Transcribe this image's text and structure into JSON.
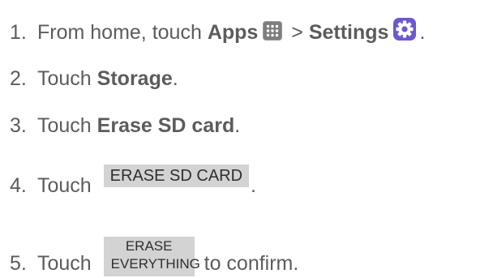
{
  "steps": [
    {
      "number": "1.",
      "text_before": "From home, touch ",
      "bold1": "Apps",
      "icon1": "apps-grid-icon",
      "sep": " > ",
      "bold2": "Settings",
      "icon2": "settings-gear-icon",
      "text_after": "."
    },
    {
      "number": "2.",
      "text_before": "Touch ",
      "bold": "Storage",
      "text_after": "."
    },
    {
      "number": "3.",
      "text_before": "Touch ",
      "bold": "Erase SD card",
      "text_after": "."
    },
    {
      "number": "4.",
      "text_before": "Touch ",
      "button_label": "ERASE SD CARD",
      "text_after": "."
    },
    {
      "number": "5.",
      "text_before": "Touch ",
      "button_line1": "ERASE",
      "button_line2": "EVERYTHING",
      "text_after": " to confirm."
    }
  ],
  "colors": {
    "text": "#5c5c5c",
    "button_bg": "#d3d3d3",
    "settings_icon": "#6a5acd"
  }
}
